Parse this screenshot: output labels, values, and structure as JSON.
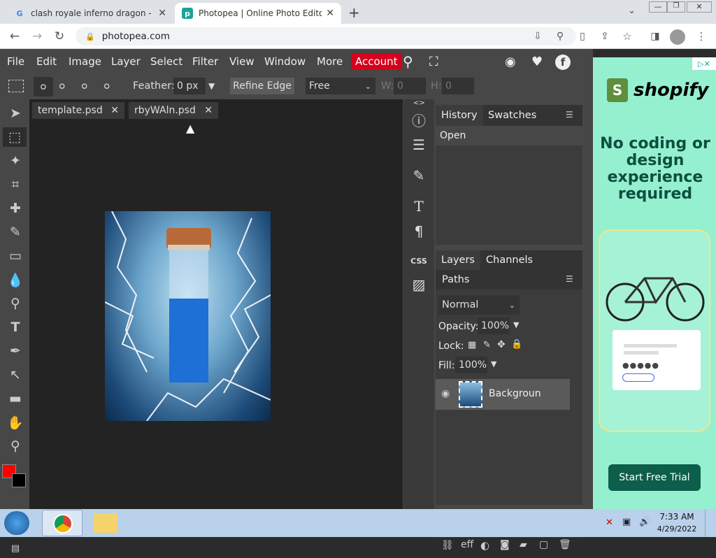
{
  "browser": {
    "tabs": [
      {
        "title": "clash royale inferno dragon - Go",
        "favicon": "google-icon"
      },
      {
        "title": "Photopea | Online Photo Editor",
        "favicon": "photopea-icon"
      }
    ],
    "url": "photopea.com"
  },
  "menu": [
    "File",
    "Edit",
    "Image",
    "Layer",
    "Select",
    "Filter",
    "View",
    "Window",
    "More"
  ],
  "account_label": "Account",
  "options": {
    "feather_label": "Feather:",
    "feather_value": "0 px",
    "refine_edge": "Refine Edge",
    "style_value": "Free",
    "w_label": "W:",
    "w_value": "0",
    "h_label": "H:",
    "h_value": "0"
  },
  "doc_tabs": [
    "template.psd",
    "rbyWAln.psd"
  ],
  "panels": {
    "history_tab": "History",
    "swatches_tab": "Swatches",
    "history_items": [
      "Open"
    ],
    "layers_tab": "Layers",
    "channels_tab": "Channels",
    "paths_tab": "Paths",
    "blend_mode": "Normal",
    "opacity_label": "Opacity:",
    "opacity_value": "100%",
    "lock_label": "Lock:",
    "fill_label": "Fill:",
    "fill_value": "100%",
    "layer_name": "Backgroun",
    "css_label": "CSS",
    "fx_label": "eff"
  },
  "ad": {
    "brand": "shopify",
    "headline": "No coding or design experience required",
    "button": "Start Free Trial"
  },
  "taskbar": {
    "time": "7:33 AM",
    "date": "4/29/2022"
  },
  "colors": {
    "foreground": "#ff0000",
    "background": "#000000",
    "accent": "#d6001c",
    "ad_bg": "#95f0cf",
    "ad_button": "#0d5e4b"
  }
}
